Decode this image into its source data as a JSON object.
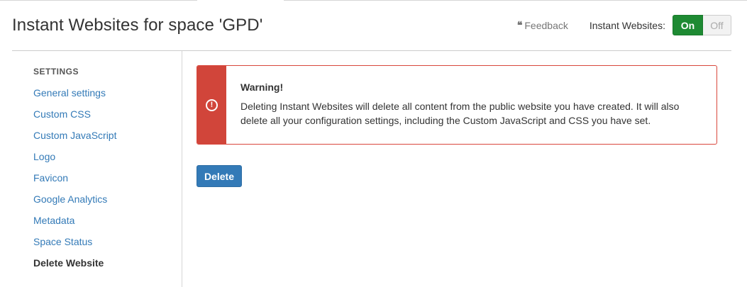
{
  "header": {
    "title": "Instant Websites for space 'GPD'",
    "feedback_label": "Feedback",
    "toggle_label": "Instant Websites:",
    "toggle_on_label": "On",
    "toggle_off_label": "Off",
    "toggle_state": "On",
    "toggle_on_color": "#1e8a33"
  },
  "sidebar": {
    "heading": "SETTINGS",
    "items": [
      {
        "label": "General settings"
      },
      {
        "label": "Custom CSS"
      },
      {
        "label": "Custom JavaScript"
      },
      {
        "label": "Logo"
      },
      {
        "label": "Favicon"
      },
      {
        "label": "Google Analytics"
      },
      {
        "label": "Metadata"
      },
      {
        "label": "Space Status"
      },
      {
        "label": "Delete Website"
      }
    ],
    "active_item": "Delete Website"
  },
  "warning": {
    "title": "Warning!",
    "message": "Deleting Instant Websites will delete all content from the public website you have created. It will also delete all your configuration settings, including the Custom JavaScript and CSS you have set.",
    "icon": "exclamation-circle-icon",
    "color": "#d1453a"
  },
  "actions": {
    "delete_label": "Delete",
    "delete_color": "#337ab7"
  }
}
